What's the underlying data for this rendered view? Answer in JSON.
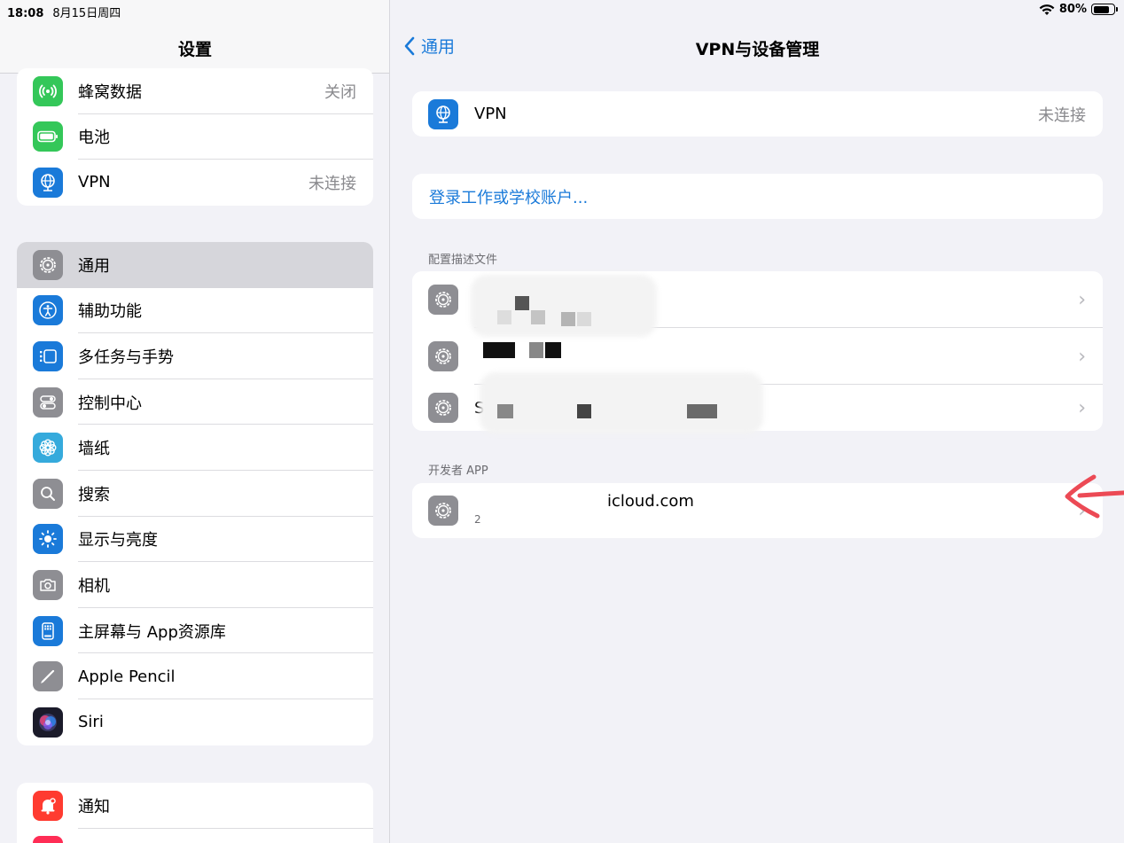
{
  "status": {
    "time": "18:08",
    "date": "8月15日周四",
    "battery": "80%",
    "battery_level": 0.8
  },
  "sidebar": {
    "title": "设置",
    "group1": [
      {
        "label": "蜂窝数据",
        "value": "关闭",
        "icon": "cellular-icon",
        "color": "#34c759"
      },
      {
        "label": "电池",
        "value": "",
        "icon": "battery-icon",
        "color": "#34c759"
      },
      {
        "label": "VPN",
        "value": "未连接",
        "icon": "vpn-icon",
        "color": "#1a7ad9"
      }
    ],
    "group2": [
      {
        "label": "通用",
        "icon": "gear-icon",
        "color": "#8e8e93"
      },
      {
        "label": "辅助功能",
        "icon": "accessibility-icon",
        "color": "#1a7ad9"
      },
      {
        "label": "多任务与手势",
        "icon": "multitasking-icon",
        "color": "#1a7ad9"
      },
      {
        "label": "控制中心",
        "icon": "control-center-icon",
        "color": "#8e8e93"
      },
      {
        "label": "墙纸",
        "icon": "wallpaper-icon",
        "color": "#35aadc"
      },
      {
        "label": "搜索",
        "icon": "search-icon",
        "color": "#8e8e93"
      },
      {
        "label": "显示与亮度",
        "icon": "brightness-icon",
        "color": "#1a7ad9"
      },
      {
        "label": "相机",
        "icon": "camera-icon",
        "color": "#8e8e93"
      },
      {
        "label": "主屏幕与 App资源库",
        "icon": "home-screen-icon",
        "color": "#1a7ad9"
      },
      {
        "label": "Apple Pencil",
        "icon": "pencil-icon",
        "color": "#8e8e93"
      },
      {
        "label": "Siri",
        "icon": "siri-icon",
        "color": "#2b2b3a"
      }
    ],
    "group3": [
      {
        "label": "通知",
        "icon": "bell-icon",
        "color": "#ff3b30"
      }
    ]
  },
  "detail": {
    "back_label": "通用",
    "title": "VPN与设备管理",
    "vpn": {
      "label": "VPN",
      "value": "未连接"
    },
    "login_link": "登录工作或学校账户...",
    "profiles_header": "配置描述文件",
    "profiles": [
      {
        "label": ""
      },
      {
        "label": ""
      },
      {
        "label": "St"
      }
    ],
    "developer_header": "开发者 APP",
    "developer_app": {
      "label": "icloud.com",
      "sub": "2"
    }
  },
  "colors": {
    "accent": "#1a7ad9",
    "selected_row": "#d6d6db",
    "annotation_arrow": "#ec4a55"
  }
}
